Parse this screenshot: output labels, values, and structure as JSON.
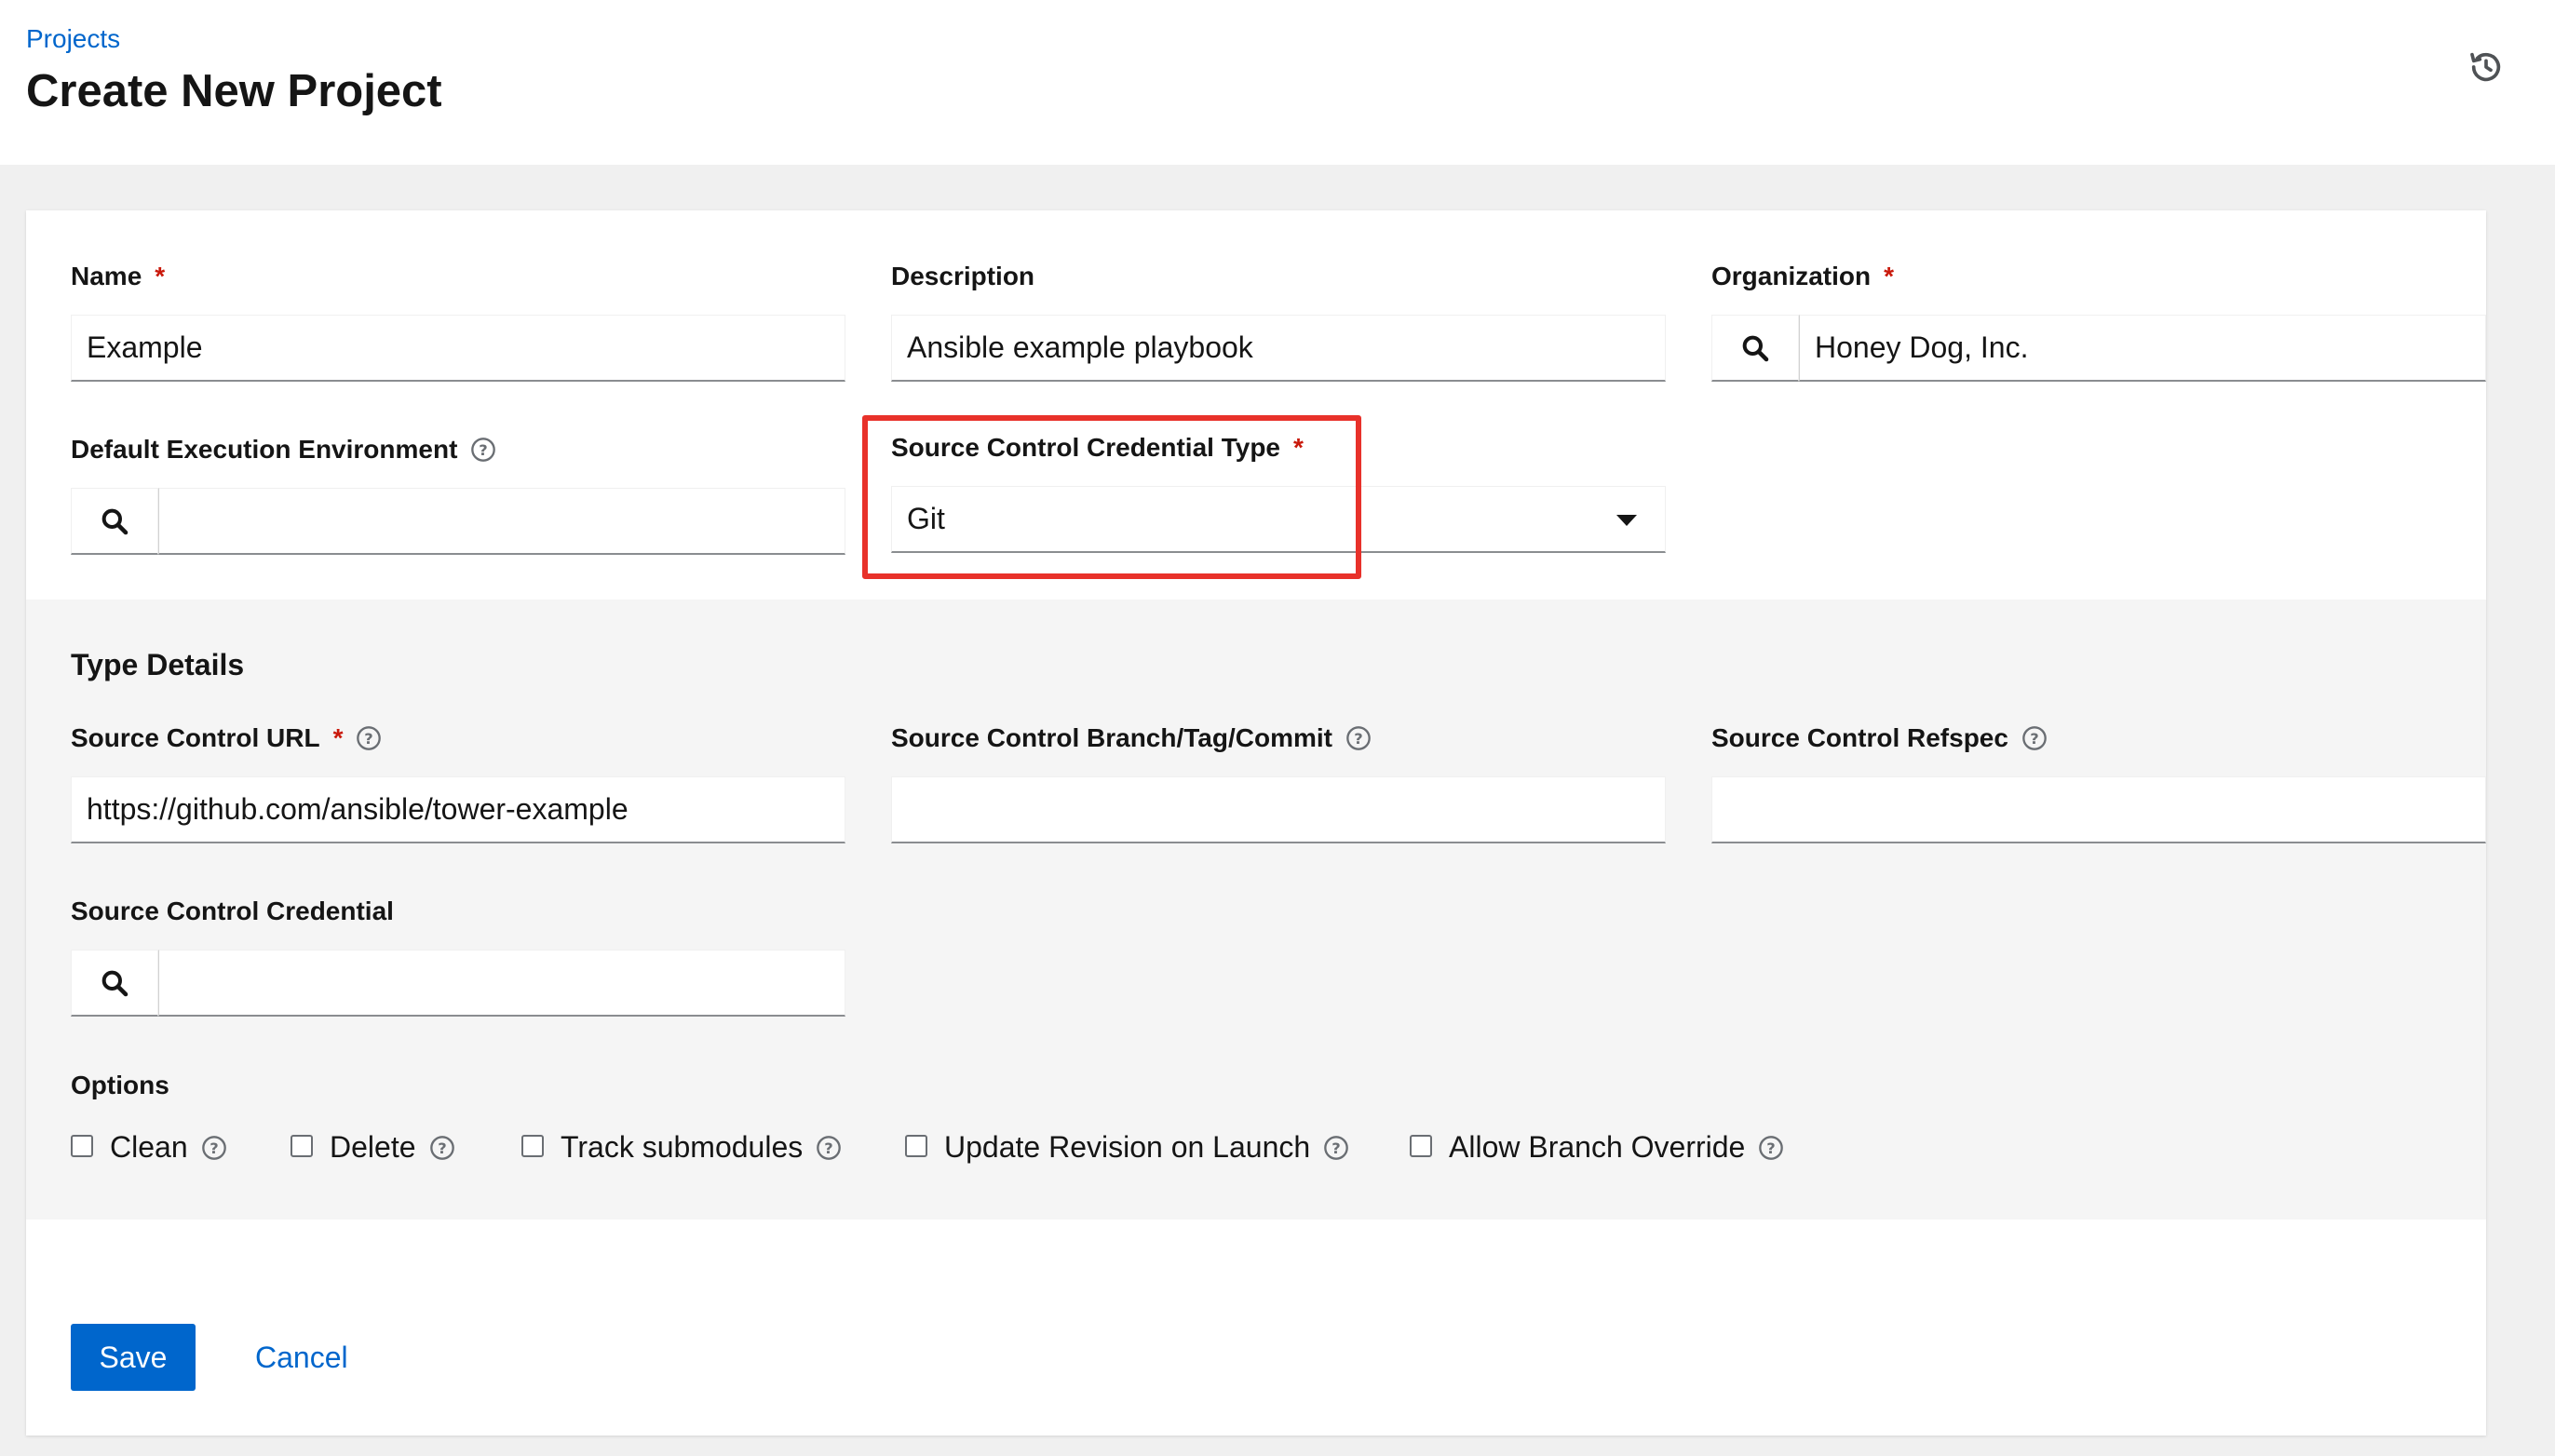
{
  "header": {
    "breadcrumb": "Projects",
    "title": "Create New Project",
    "history_icon": "history-icon"
  },
  "form": {
    "name": {
      "label": "Name",
      "required": "*",
      "value": "Example"
    },
    "description": {
      "label": "Description",
      "value": "Ansible example playbook"
    },
    "organization": {
      "label": "Organization",
      "required": "*",
      "value": "Honey Dog, Inc."
    },
    "execution_environment": {
      "label": "Default Execution Environment",
      "value": ""
    },
    "scm_type": {
      "label": "Source Control Credential Type",
      "required": "*",
      "value": "Git"
    }
  },
  "type_details": {
    "title": "Type Details",
    "scm_url": {
      "label": "Source Control URL",
      "required": "*",
      "value": "https://github.com/ansible/tower-example"
    },
    "scm_branch": {
      "label": "Source Control Branch/Tag/Commit",
      "value": ""
    },
    "scm_refspec": {
      "label": "Source Control Refspec",
      "value": ""
    },
    "scm_credential": {
      "label": "Source Control Credential",
      "value": ""
    },
    "options": {
      "label": "Options",
      "items": [
        {
          "label": "Clean",
          "checked": false
        },
        {
          "label": "Delete",
          "checked": false
        },
        {
          "label": "Track submodules",
          "checked": false
        },
        {
          "label": "Update Revision on Launch",
          "checked": false
        },
        {
          "label": "Allow Branch Override",
          "checked": false
        }
      ]
    }
  },
  "actions": {
    "save": "Save",
    "cancel": "Cancel"
  },
  "colors": {
    "primary": "#0066cc",
    "required": "#c9190b",
    "highlight": "#e8312a"
  }
}
